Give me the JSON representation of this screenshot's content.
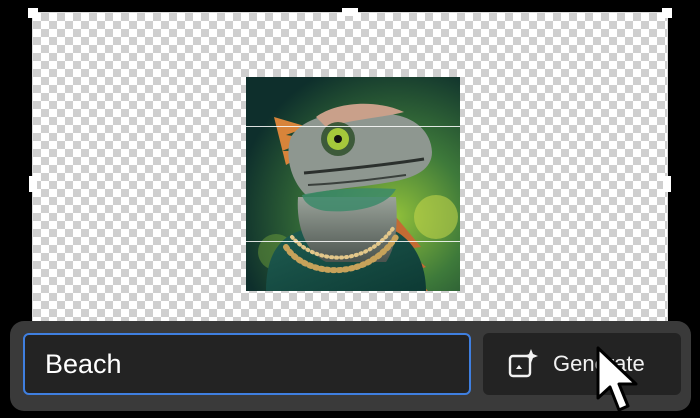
{
  "canvas": {
    "subject_description_icon": "lizard-image"
  },
  "prompt": {
    "value": "Beach",
    "placeholder": ""
  },
  "generate": {
    "label": "Generate",
    "icon": "sparkle-frame-icon"
  },
  "colors": {
    "accent_border": "#3f7fe0",
    "bar_background": "#3a3a3a",
    "control_background": "#232323"
  }
}
